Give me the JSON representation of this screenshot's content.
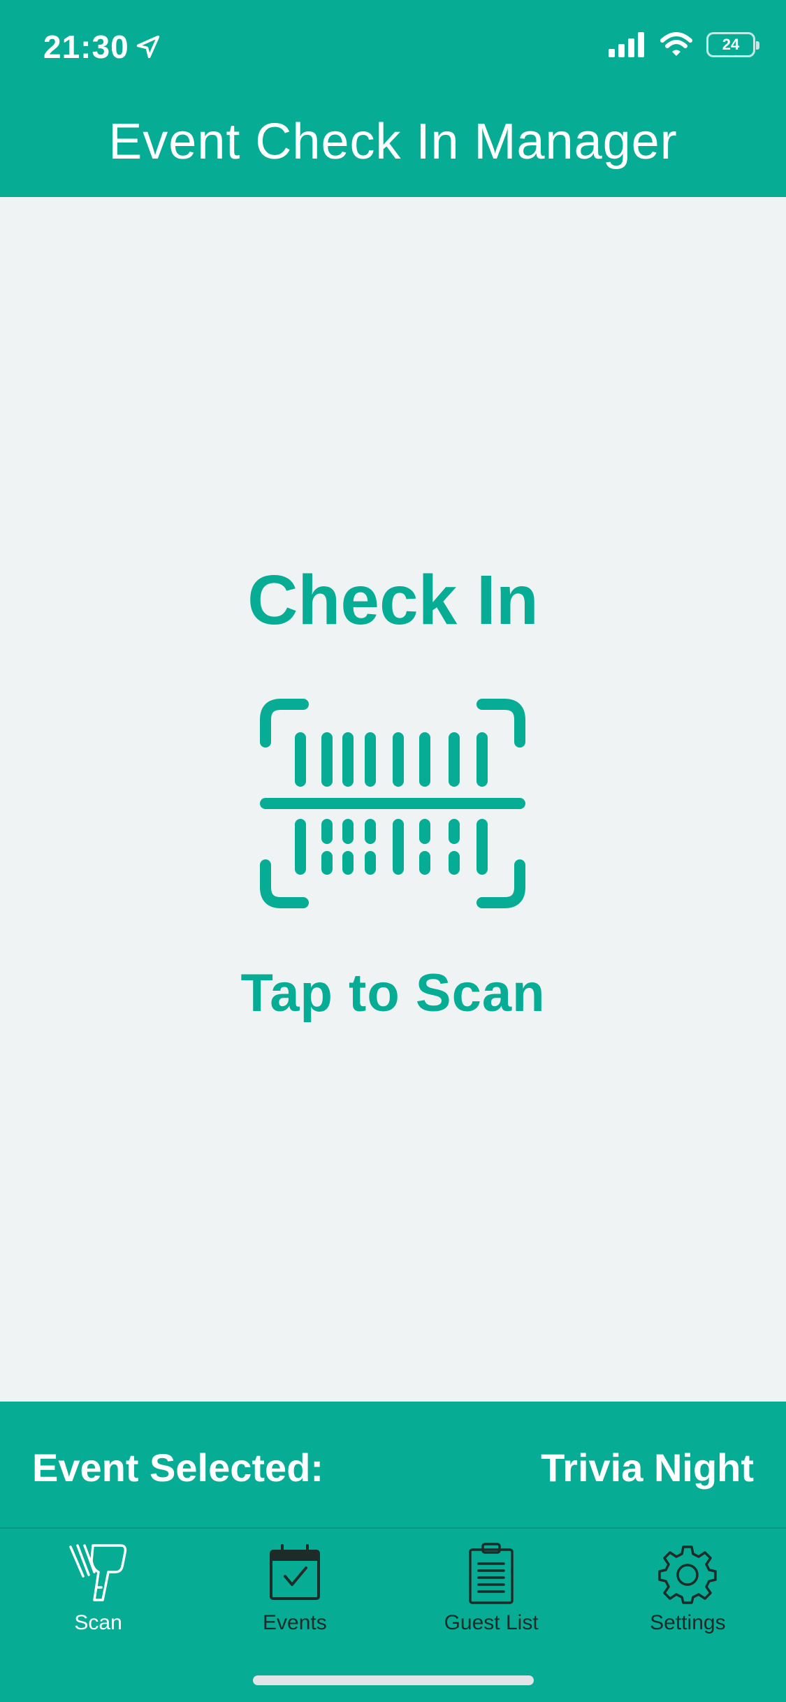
{
  "status_bar": {
    "time": "21:30",
    "battery": "24"
  },
  "header": {
    "title": "Event Check In Manager"
  },
  "main": {
    "title": "Check In",
    "tap_label": "Tap to Scan"
  },
  "event_bar": {
    "label": "Event Selected:",
    "value": "Trivia Night"
  },
  "tabs": [
    {
      "label": "Scan",
      "icon": "barcode-scanner-icon"
    },
    {
      "label": "Events",
      "icon": "calendar-check-icon"
    },
    {
      "label": "Guest List",
      "icon": "clipboard-list-icon"
    },
    {
      "label": "Settings",
      "icon": "gear-icon"
    }
  ],
  "colors": {
    "accent": "#06ad94",
    "background": "#f0f3f4",
    "inactive_tab": "#1d2b29"
  }
}
